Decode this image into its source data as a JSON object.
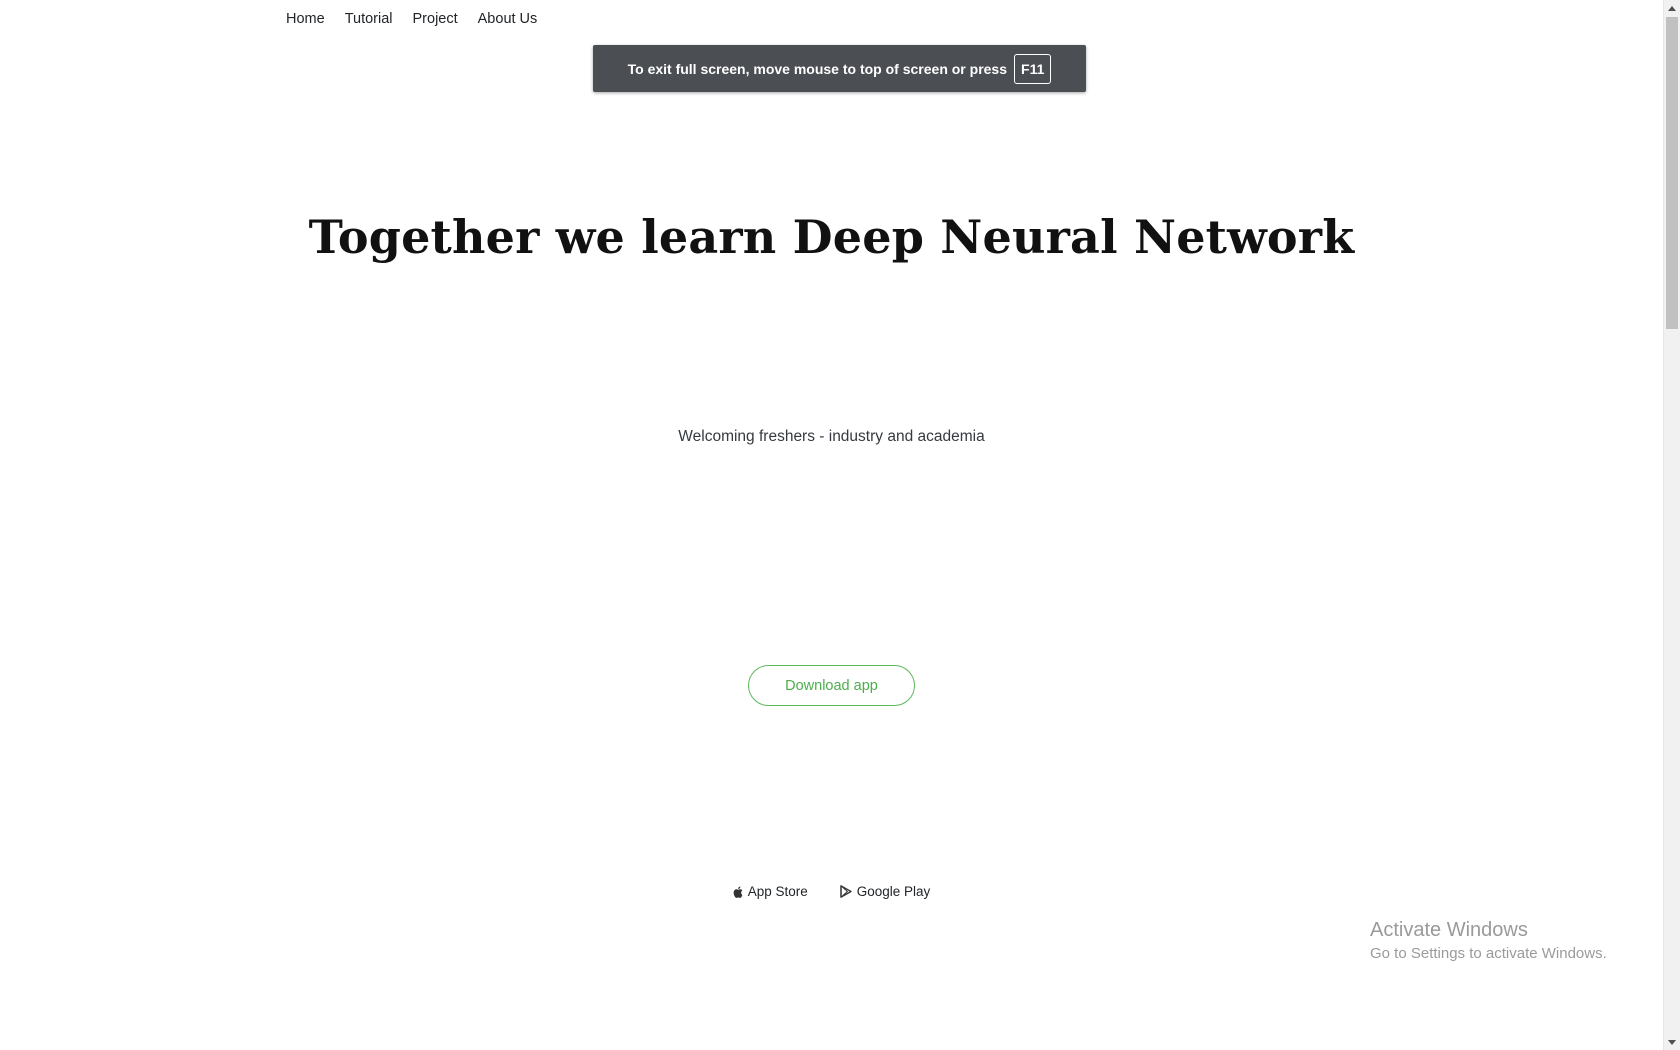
{
  "nav": {
    "items": [
      {
        "label": "Home"
      },
      {
        "label": "Tutorial"
      },
      {
        "label": "Project"
      },
      {
        "label": "About Us"
      }
    ]
  },
  "fullscreen_toast": {
    "message": "To exit full screen, move mouse to top of screen or press",
    "key": "F11"
  },
  "hero": {
    "title": "Together we learn Deep Neural Network",
    "subtitle": "Welcoming freshers - industry and academia",
    "button_label": "Download app",
    "accent_color": "#5cb85c"
  },
  "stores": [
    {
      "label": "App Store",
      "icon": "apple-icon"
    },
    {
      "label": "Google Play",
      "icon": "play-icon"
    }
  ],
  "watermark": {
    "line1": "Activate Windows",
    "line2": "Go to Settings to activate Windows."
  }
}
